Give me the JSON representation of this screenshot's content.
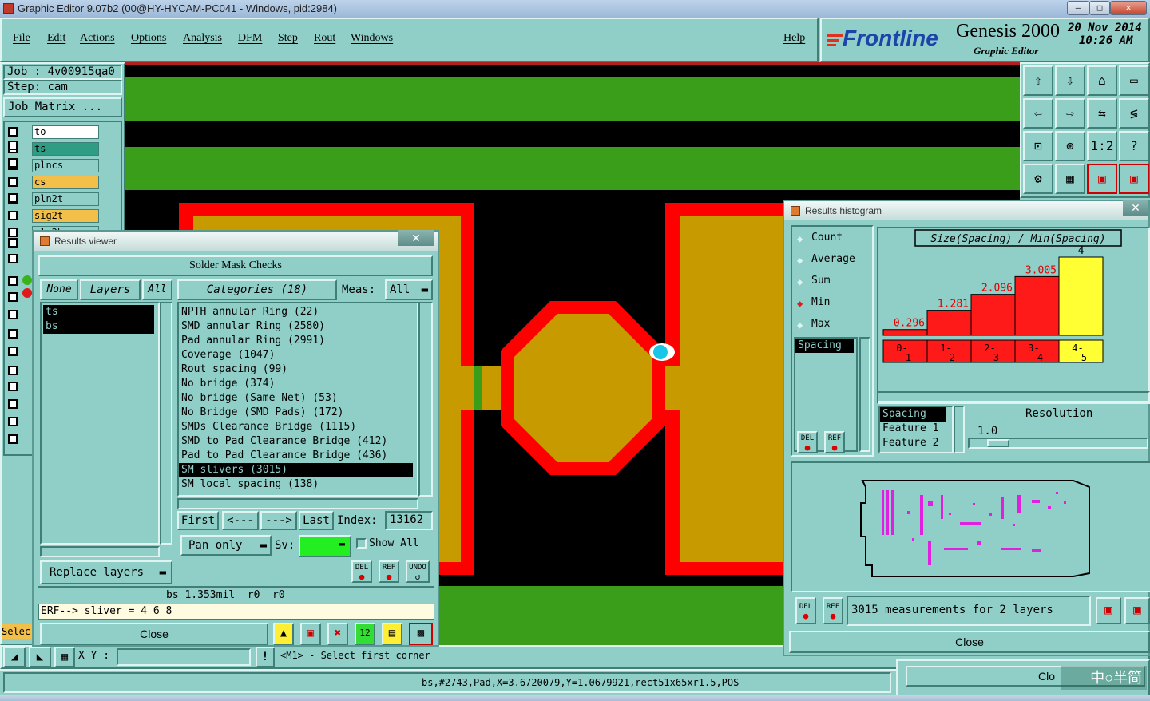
{
  "window": {
    "title": "Graphic Editor 9.07b2 (00@HY-HYCAM-PC041 - Windows, pid:2984)"
  },
  "menu": {
    "file": "File",
    "edit": "Edit",
    "actions": "Actions",
    "options": "Options",
    "analysis": "Analysis",
    "dfm": "DFM",
    "step": "Step",
    "rout": "Rout",
    "windows": "Windows",
    "help": "Help"
  },
  "brand": {
    "logo": "Frontline",
    "product": "Genesis 2000",
    "subtitle": "Graphic Editor",
    "date": "20 Nov 2014",
    "time": "10:26 AM"
  },
  "job": {
    "job_label": "Job : 4v00915qa0",
    "step_label": "Step: cam",
    "matrix_button": "Job Matrix ..."
  },
  "layers": [
    {
      "name": "to",
      "color": "#ffffff"
    },
    {
      "name": "ts",
      "color": "#2f9c84"
    },
    {
      "name": "plncs",
      "color": "#8fcfc8"
    },
    {
      "name": "cs",
      "color": "#f2c04a"
    },
    {
      "name": "pln2t",
      "color": "#8fcfc8"
    },
    {
      "name": "sig2t",
      "color": "#f2c04a"
    },
    {
      "name": "pln3b",
      "color": "#8fcfc8"
    }
  ],
  "bottom_left": {
    "select_label": "Selec",
    "xy_label": "X Y :",
    "status_prompt": "<M1> - Select first corner"
  },
  "status_bar": "bs,#2743,Pad,X=3.6720079,Y=1.0679921,rect51x65xr1.5,POS",
  "results_viewer": {
    "title": "Results viewer",
    "header": "Solder Mask Checks",
    "none_btn": "None",
    "layers_btn": "Layers",
    "all_btn": "All",
    "layer_list": [
      "ts",
      "bs"
    ],
    "categories_btn": "Categories (18)",
    "meas_label": "Meas:",
    "meas_value": "All",
    "categories": [
      "NPTH annular Ring (22)",
      "SMD annular Ring (2580)",
      "Pad annular Ring (2991)",
      "Coverage (1047)",
      "Rout spacing (99)",
      "No bridge (374)",
      "No bridge (Same Net) (53)",
      "No Bridge (SMD Pads) (172)",
      "SMDs Clearance Bridge (1115)",
      "SMD to Pad Clearance Bridge (412)",
      "Pad to Pad Clearance Bridge (436)",
      "SM slivers (3015)",
      "SM local spacing (138)"
    ],
    "selected_index": 11,
    "first_btn": "First",
    "prev_btn": "<---",
    "next_btn": "--->",
    "last_btn": "Last",
    "index_label": "Index:",
    "index_value": "13162",
    "pan_only": "Pan only",
    "sv_label": "Sv:",
    "show_all": "Show All",
    "replace_layers": "Replace layers",
    "del": "DEL",
    "ref": "REF",
    "undo": "UNDO",
    "info_line": "bs 1.353mil  r0  r0",
    "erf_line": "ERF--> sliver = 4 6 8",
    "close": "Close"
  },
  "histogram": {
    "title": "Results histogram",
    "options": [
      "Count",
      "Average",
      "Sum",
      "Min",
      "Max"
    ],
    "selected_option": "Min",
    "list_item": "Spacing",
    "chart_title": "Size(Spacing) / Min(Spacing)",
    "bars": [
      {
        "label": "0.296",
        "value": 0.296,
        "range_top": "0-",
        "range_bot": "1"
      },
      {
        "label": "1.281",
        "value": 1.281,
        "range_top": "1-",
        "range_bot": "2"
      },
      {
        "label": "2.096",
        "value": 2.096,
        "range_top": "2-",
        "range_bot": "3"
      },
      {
        "label": "3.005",
        "value": 3.005,
        "range_top": "3-",
        "range_bot": "4"
      },
      {
        "label": "4",
        "value": 4,
        "range_top": "4-",
        "range_bot": "5"
      }
    ],
    "field_list": [
      "Spacing",
      "Feature 1",
      "Feature 2"
    ],
    "resolution_label": "Resolution",
    "resolution_value": "1.0",
    "del": "DEL",
    "ref": "REF",
    "measurements": "3015 measurements for 2 layers",
    "close": "Close",
    "colors": {
      "bar": "#ff1a1a",
      "highlight": "#ffff33"
    }
  },
  "background_window": {
    "close_label": "Clo"
  },
  "watermark": "中○半简",
  "colors": {
    "panel": "#8fcfc8",
    "copper": "#c79a00",
    "mask": "#ff0000",
    "green": "#3a9e1a"
  }
}
